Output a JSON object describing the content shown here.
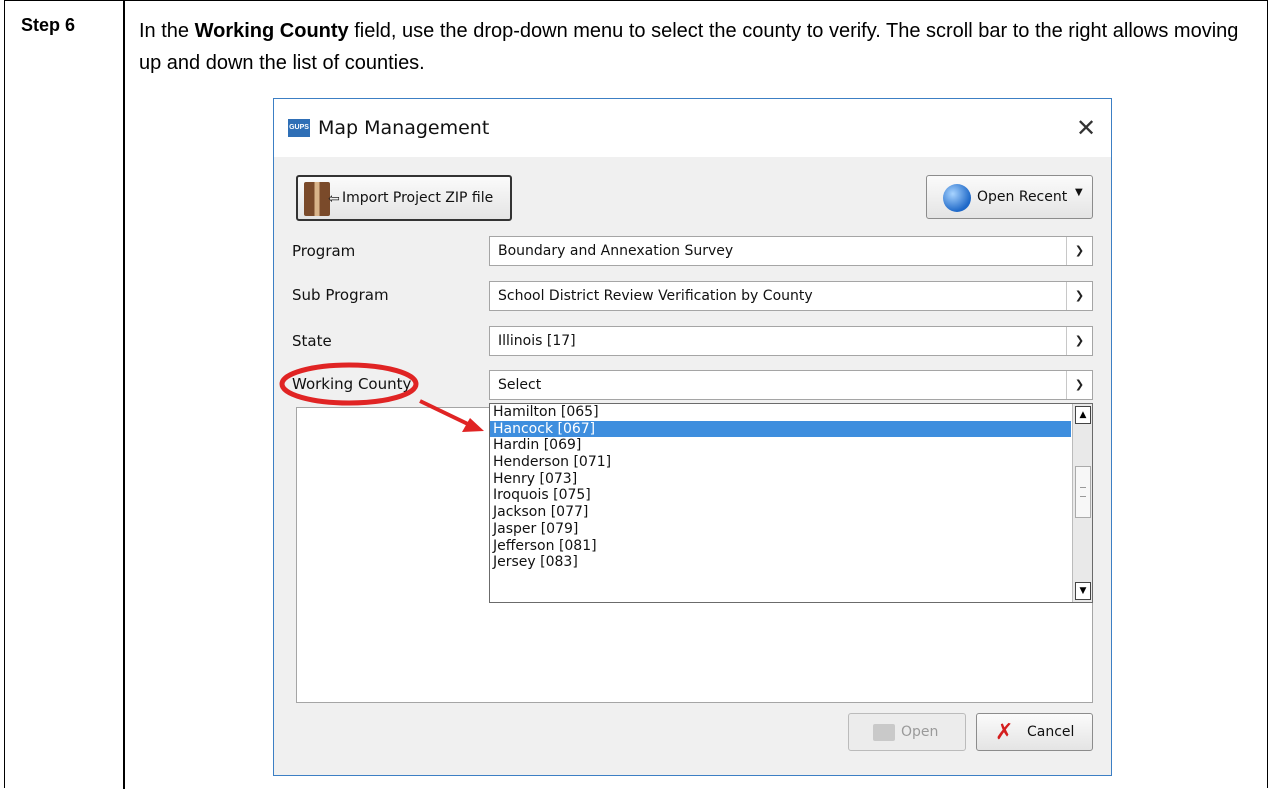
{
  "step": {
    "label": "Step 6",
    "instruction_pre": "In the ",
    "instruction_bold": "Working County",
    "instruction_post": " field, use the drop-down menu to select the county to verify. The scroll bar to the right allows moving up and down the list of counties."
  },
  "dialog": {
    "app_icon": "GUPS",
    "title": "Map Management",
    "close_icon": "close-icon",
    "import_button": "Import Project ZIP file",
    "recent_button": "Open Recent",
    "fields": {
      "program": {
        "label": "Program",
        "value": "Boundary and Annexation Survey"
      },
      "sub_program": {
        "label": "Sub Program",
        "value": "School District Review Verification by County"
      },
      "state": {
        "label": "State",
        "value": "Illinois [17]"
      },
      "working_county": {
        "label": "Working County",
        "value": "Select"
      }
    },
    "dropdown_items": [
      "Hamilton [065]",
      "Hancock [067]",
      "Hardin [069]",
      "Henderson [071]",
      "Henry [073]",
      "Iroquois [075]",
      "Jackson [077]",
      "Jasper [079]",
      "Jefferson [081]",
      "Jersey [083]"
    ],
    "selected_item": "Hancock [067]",
    "open_button": "Open",
    "cancel_button": "Cancel"
  },
  "colors": {
    "dialog_border": "#3c7fc4",
    "selection": "#3e8ede",
    "annotation": "#e02424"
  }
}
